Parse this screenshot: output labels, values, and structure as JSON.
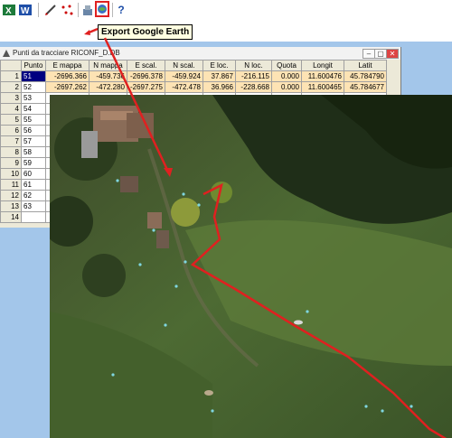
{
  "toolbar": {
    "buttons": [
      {
        "name": "excel-icon",
        "glyph": "X",
        "label": "Excel"
      },
      {
        "name": "word-icon",
        "glyph": "W",
        "label": "Word"
      },
      {
        "name": "pen-icon",
        "glyph": "✎",
        "label": "Edit"
      },
      {
        "name": "points-icon",
        "glyph": "⁛",
        "label": "Points"
      },
      {
        "name": "export-google-earth-icon",
        "glyph": "⟳",
        "label": "Export Google Earth"
      },
      {
        "name": "help-icon",
        "glyph": "?",
        "label": "Help"
      }
    ]
  },
  "tooltip": {
    "text": "Export Google Earth"
  },
  "window": {
    "title": "Punti da tracciare RICONF_D.DB",
    "controls": {
      "minimize": "–",
      "restore": "▢",
      "close": "✕"
    }
  },
  "table": {
    "columns": [
      "Punto",
      "E mappa",
      "N mappa",
      "E scal.",
      "N scal.",
      "E loc.",
      "N loc.",
      "Quota",
      "Longit",
      "Latit"
    ],
    "rows": [
      {
        "n": "1",
        "punto": "51",
        "cells": [
          "-2696.366",
          "-459.736",
          "-2696.378",
          "-459.924",
          "37.867",
          "-216.115",
          "0.000",
          "11.600476",
          "45.784790"
        ]
      },
      {
        "n": "2",
        "punto": "52",
        "cells": [
          "-2697.262",
          "-472.280",
          "-2697.275",
          "-472.478",
          "36.966",
          "-228.668",
          "0.000",
          "11.600465",
          "45.784677"
        ]
      },
      {
        "n": "3",
        "punto": "53",
        "cells": []
      },
      {
        "n": "4",
        "punto": "54",
        "cells": []
      },
      {
        "n": "5",
        "punto": "55",
        "cells": []
      },
      {
        "n": "6",
        "punto": "56",
        "cells": []
      },
      {
        "n": "7",
        "punto": "57",
        "cells": []
      },
      {
        "n": "8",
        "punto": "58",
        "cells": []
      },
      {
        "n": "9",
        "punto": "59",
        "cells": []
      },
      {
        "n": "10",
        "punto": "60",
        "cells": []
      },
      {
        "n": "11",
        "punto": "61",
        "cells": []
      },
      {
        "n": "12",
        "punto": "62",
        "cells": []
      },
      {
        "n": "13",
        "punto": "63",
        "cells": []
      },
      {
        "n": "14",
        "punto": "",
        "cells": []
      }
    ]
  },
  "colors": {
    "accent_red": "#e02020",
    "desktop_blue": "#a3c6ea",
    "cell_orange": "#fde3b4",
    "selected": "#000080"
  }
}
